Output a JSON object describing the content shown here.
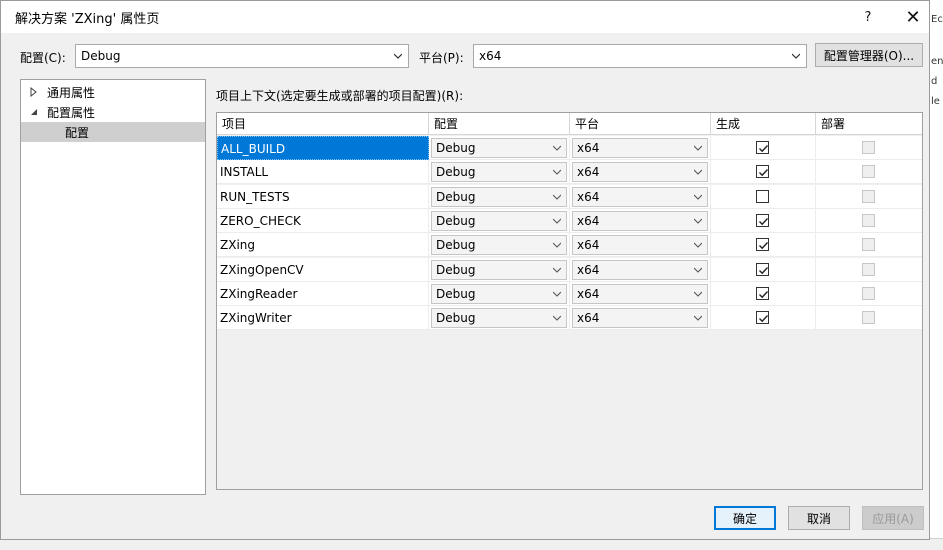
{
  "window": {
    "title": "解决方案 'ZXing' 属性页",
    "help_glyph": "?",
    "close_glyph": "✕"
  },
  "config_bar": {
    "config_label": "配置(C):",
    "config_value": "Debug",
    "platform_label": "平台(P):",
    "platform_value": "x64",
    "manager_button": "配置管理器(O)..."
  },
  "tree": {
    "items": [
      {
        "label": "通用属性",
        "icon": "expand-arrow-icon"
      },
      {
        "label": "配置属性",
        "icon": "collapse-arrow-icon"
      },
      {
        "label": "配置",
        "icon": ""
      }
    ],
    "selected": "配置"
  },
  "grid": {
    "caption": "项目上下文(选定要生成或部署的项目配置)(R):",
    "headers": [
      "项目",
      "配置",
      "平台",
      "生成",
      "部署"
    ],
    "rows": [
      {
        "project": "ALL_BUILD",
        "config": "Debug",
        "platform": "x64",
        "build": true,
        "deploy": false
      },
      {
        "project": "INSTALL",
        "config": "Debug",
        "platform": "x64",
        "build": true,
        "deploy": false
      },
      {
        "project": "RUN_TESTS",
        "config": "Debug",
        "platform": "x64",
        "build": false,
        "deploy": false
      },
      {
        "project": "ZERO_CHECK",
        "config": "Debug",
        "platform": "x64",
        "build": true,
        "deploy": false
      },
      {
        "project": "ZXing",
        "config": "Debug",
        "platform": "x64",
        "build": true,
        "deploy": false
      },
      {
        "project": "ZXingOpenCV",
        "config": "Debug",
        "platform": "x64",
        "build": true,
        "deploy": false
      },
      {
        "project": "ZXingReader",
        "config": "Debug",
        "platform": "x64",
        "build": true,
        "deploy": false
      },
      {
        "project": "ZXingWriter",
        "config": "Debug",
        "platform": "x64",
        "build": true,
        "deploy": false
      }
    ],
    "selected_row": "ALL_BUILD"
  },
  "buttons": {
    "ok": "确定",
    "cancel": "取消",
    "apply": "应用(A)"
  },
  "background": {
    "right_text": [
      "Ec",
      "en",
      "d",
      "le"
    ]
  },
  "colors": {
    "selection": "#0078d7",
    "default_button_border": "#0078d7"
  }
}
